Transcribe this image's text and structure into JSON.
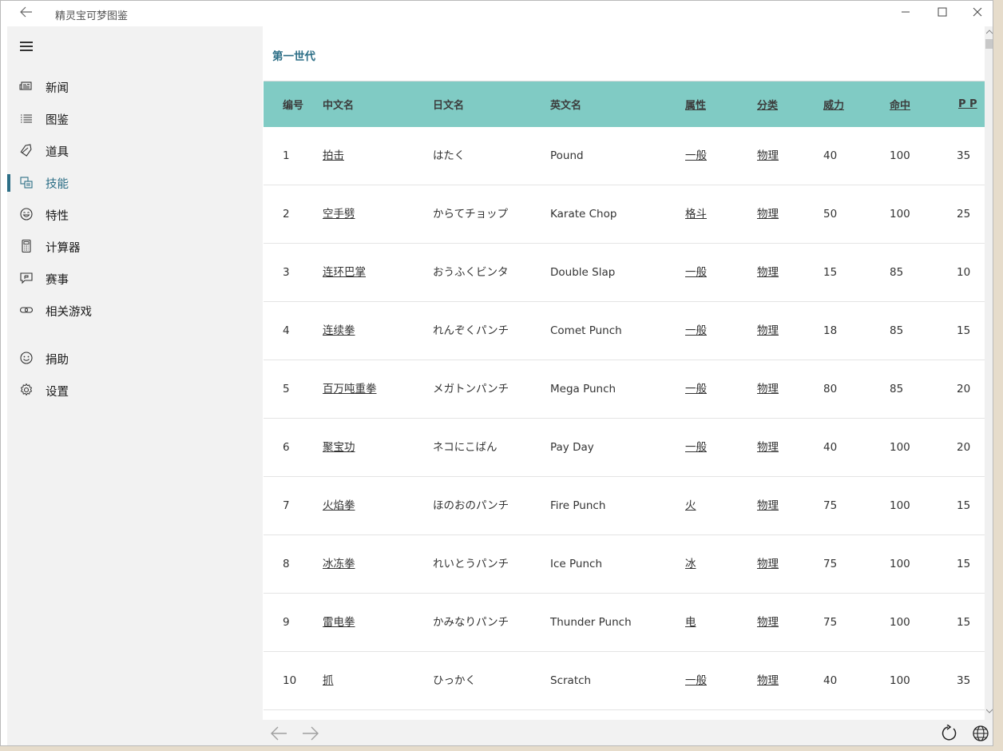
{
  "window": {
    "title": "精灵宝可梦图鉴",
    "controls": {
      "minimize": "—",
      "maximize": "☐",
      "close": "✕"
    }
  },
  "sidebar": {
    "items": [
      {
        "label": "新闻",
        "icon": "news-icon",
        "active": false
      },
      {
        "label": "图鉴",
        "icon": "list-icon",
        "active": false
      },
      {
        "label": "道具",
        "icon": "tag-icon",
        "active": false
      },
      {
        "label": "技能",
        "icon": "skill-icon",
        "active": true
      },
      {
        "label": "特性",
        "icon": "emoji-icon",
        "active": false
      },
      {
        "label": "计算器",
        "icon": "calculator-icon",
        "active": false
      },
      {
        "label": "赛事",
        "icon": "event-icon",
        "active": false
      },
      {
        "label": "相关游戏",
        "icon": "link-icon",
        "active": false
      },
      {
        "label": "捐助",
        "icon": "smile-icon",
        "active": false
      },
      {
        "label": "设置",
        "icon": "gear-icon",
        "active": false
      }
    ]
  },
  "main": {
    "section_title": "第一世代",
    "table": {
      "headers": [
        "编号",
        "中文名",
        "日文名",
        "英文名",
        "属性",
        "分类",
        "威力",
        "命中",
        "P P"
      ],
      "rows": [
        {
          "no": "1",
          "cn": "拍击",
          "jp": "はたく",
          "en": "Pound",
          "type": "一般",
          "cat": "物理",
          "power": "40",
          "acc": "100",
          "pp": "35"
        },
        {
          "no": "2",
          "cn": "空手劈",
          "jp": "からてチョップ",
          "en": "Karate Chop",
          "type": "格斗",
          "cat": "物理",
          "power": "50",
          "acc": "100",
          "pp": "25"
        },
        {
          "no": "3",
          "cn": "连环巴掌",
          "jp": "おうふくビンタ",
          "en": "Double Slap",
          "type": "一般",
          "cat": "物理",
          "power": "15",
          "acc": "85",
          "pp": "10"
        },
        {
          "no": "4",
          "cn": "连续拳",
          "jp": "れんぞくパンチ",
          "en": "Comet Punch",
          "type": "一般",
          "cat": "物理",
          "power": "18",
          "acc": "85",
          "pp": "15"
        },
        {
          "no": "5",
          "cn": "百万吨重拳",
          "jp": "メガトンパンチ",
          "en": "Mega Punch",
          "type": "一般",
          "cat": "物理",
          "power": "80",
          "acc": "85",
          "pp": "20"
        },
        {
          "no": "6",
          "cn": "聚宝功",
          "jp": "ネコにこばん",
          "en": "Pay Day",
          "type": "一般",
          "cat": "物理",
          "power": "40",
          "acc": "100",
          "pp": "20"
        },
        {
          "no": "7",
          "cn": "火焰拳",
          "jp": "ほのおのパンチ",
          "en": "Fire Punch",
          "type": "火",
          "cat": "物理",
          "power": "75",
          "acc": "100",
          "pp": "15"
        },
        {
          "no": "8",
          "cn": "冰冻拳",
          "jp": "れいとうパンチ",
          "en": "Ice Punch",
          "type": "冰",
          "cat": "物理",
          "power": "75",
          "acc": "100",
          "pp": "15"
        },
        {
          "no": "9",
          "cn": "雷电拳",
          "jp": "かみなりパンチ",
          "en": "Thunder Punch",
          "type": "电",
          "cat": "物理",
          "power": "75",
          "acc": "100",
          "pp": "15"
        },
        {
          "no": "10",
          "cn": "抓",
          "jp": "ひっかく",
          "en": "Scratch",
          "type": "一般",
          "cat": "物理",
          "power": "40",
          "acc": "100",
          "pp": "35"
        }
      ]
    }
  },
  "colors": {
    "accent": "#2c6e86",
    "header_bg": "#80cbc4",
    "sidebar_bg": "#f2f2f2"
  }
}
